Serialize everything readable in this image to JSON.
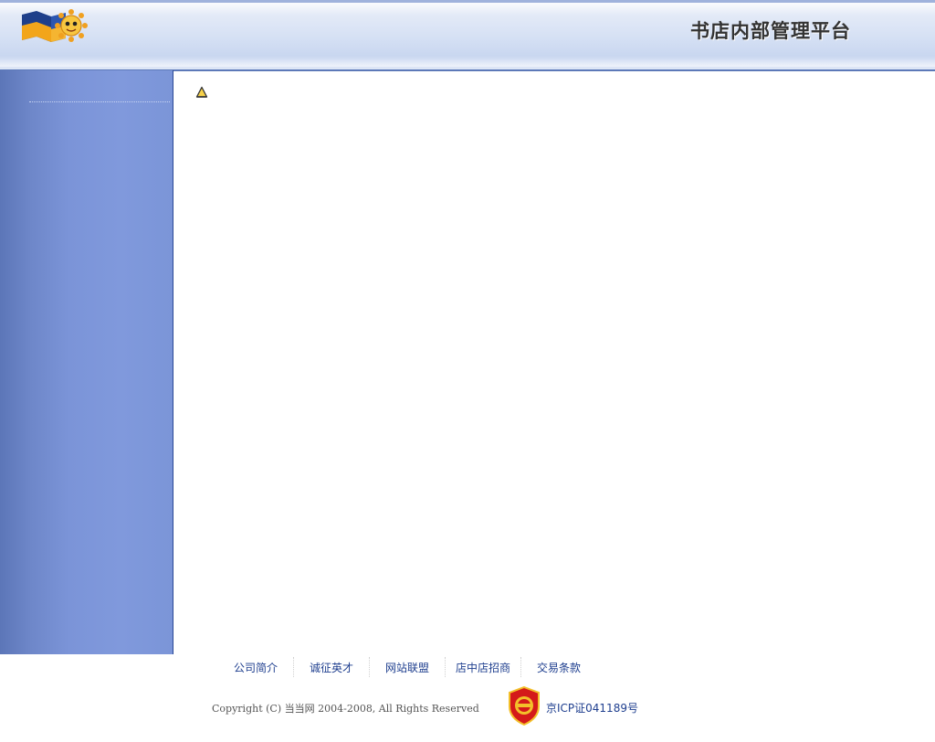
{
  "header": {
    "title": "书店内部管理平台"
  },
  "footer": {
    "links": [
      "公司简介",
      "诚征英才",
      "网站联盟",
      "店中店招商",
      "交易条款"
    ],
    "copyright": "Copyright (C) 当当网 2004-2008, All Rights Reserved",
    "icp": "京ICP证041189号"
  },
  "colors": {
    "sidebar": "#7b94d8",
    "link": "#1f3f8f",
    "title": "#333333"
  }
}
